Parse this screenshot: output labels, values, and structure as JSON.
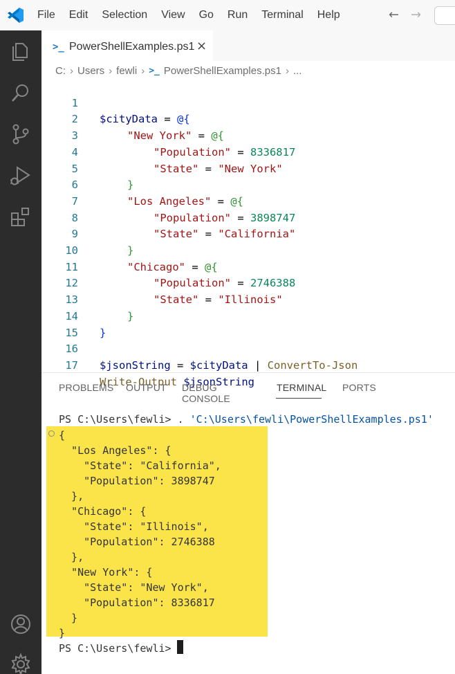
{
  "menu": [
    "File",
    "Edit",
    "Selection",
    "View",
    "Go",
    "Run",
    "Terminal",
    "Help"
  ],
  "icons": {
    "logo": "vscode-logo-icon",
    "back": "←",
    "forward": "→"
  },
  "tab": {
    "label": "PowerShellExamples.ps1",
    "close": "×",
    "glyph": ">_"
  },
  "breadcrumb": [
    "C:",
    "Users",
    "fewli",
    "PowerShellExamples.ps1",
    "..."
  ],
  "editor": {
    "lines": [
      {
        "n": "1"
      },
      {
        "n": "2"
      },
      {
        "n": "3"
      },
      {
        "n": "4"
      },
      {
        "n": "5"
      },
      {
        "n": "6"
      },
      {
        "n": "7"
      },
      {
        "n": "8"
      },
      {
        "n": "9"
      },
      {
        "n": "10"
      },
      {
        "n": "11"
      },
      {
        "n": "12"
      },
      {
        "n": "13"
      },
      {
        "n": "14"
      },
      {
        "n": "15"
      },
      {
        "n": "16"
      },
      {
        "n": "17"
      }
    ],
    "tokens": {
      "cityData": "$cityData",
      "eq": " = ",
      "open_at": "@{",
      "ny": "\"New York\"",
      "la": "\"Los Angeles\"",
      "chi": "\"Chicago\"",
      "population": "\"Population\"",
      "state": "\"State\"",
      "ny_pop": "8336817",
      "la_pop": "3898747",
      "chi_pop": "2746388",
      "ny_state": "\"New York\"",
      "la_state": "\"California\"",
      "chi_state": "\"Illinois\"",
      "close": "}",
      "jsonString": "$jsonString",
      "pipe": " | ",
      "convert": "ConvertTo-Json",
      "write": "Write-Output",
      "space": " "
    }
  },
  "panel": {
    "tabs": [
      "PROBLEMS",
      "OUTPUT",
      "DEBUG CONSOLE",
      "TERMINAL",
      "PORTS"
    ],
    "active": "TERMINAL"
  },
  "terminal": {
    "prompt": "PS C:\\Users\\fewli> ",
    "command_prefix": ". ",
    "command_path": "'C:\\Users\\fewli\\PowerShellExamples.ps1'",
    "output": [
      "{",
      "  \"Los Angeles\": {",
      "    \"State\": \"California\",",
      "    \"Population\": 3898747",
      "  },",
      "  \"Chicago\": {",
      "    \"State\": \"Illinois\",",
      "    \"Population\": 2746388",
      "  },",
      "  \"New York\": {",
      "    \"State\": \"New York\",",
      "    \"Population\": 8336817",
      "  }",
      "}"
    ],
    "final_prompt": "PS C:\\Users\\fewli> "
  },
  "colors": {
    "activity_bar": "#2c2c2c",
    "highlight": "#fbe44a",
    "accent": "#1f7bc1"
  }
}
